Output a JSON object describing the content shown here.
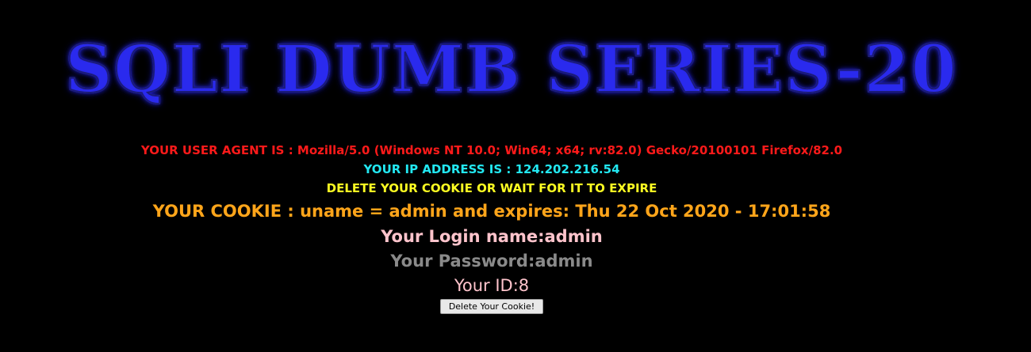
{
  "banner": {
    "title": "SQLI DUMB SERIES-20"
  },
  "info": {
    "user_agent": "YOUR USER AGENT IS : Mozilla/5.0 (Windows NT 10.0; Win64; x64; rv:82.0) Gecko/20100101 Firefox/82.0",
    "ip_address": "YOUR IP ADDRESS IS : 124.202.216.54",
    "delete_notice": "DELETE YOUR COOKIE OR WAIT FOR IT TO EXPIRE",
    "cookie": "YOUR COOKIE : uname = admin and expires: Thu 22 Oct 2020 - 17:01:58",
    "login_name": "Your Login name:admin",
    "password": "Your Password:admin",
    "user_id": "Your ID:8"
  },
  "actions": {
    "delete_button": "Delete Your Cookie!"
  },
  "colors": {
    "background": "#000000",
    "user_agent": "#ff1a1a",
    "ip_address": "#22e8f2",
    "delete_notice": "#ffff22",
    "cookie": "#ffa51a",
    "login_name": "#ffc4cc",
    "password": "#8a8a8a",
    "user_id": "#ffc4cc"
  }
}
